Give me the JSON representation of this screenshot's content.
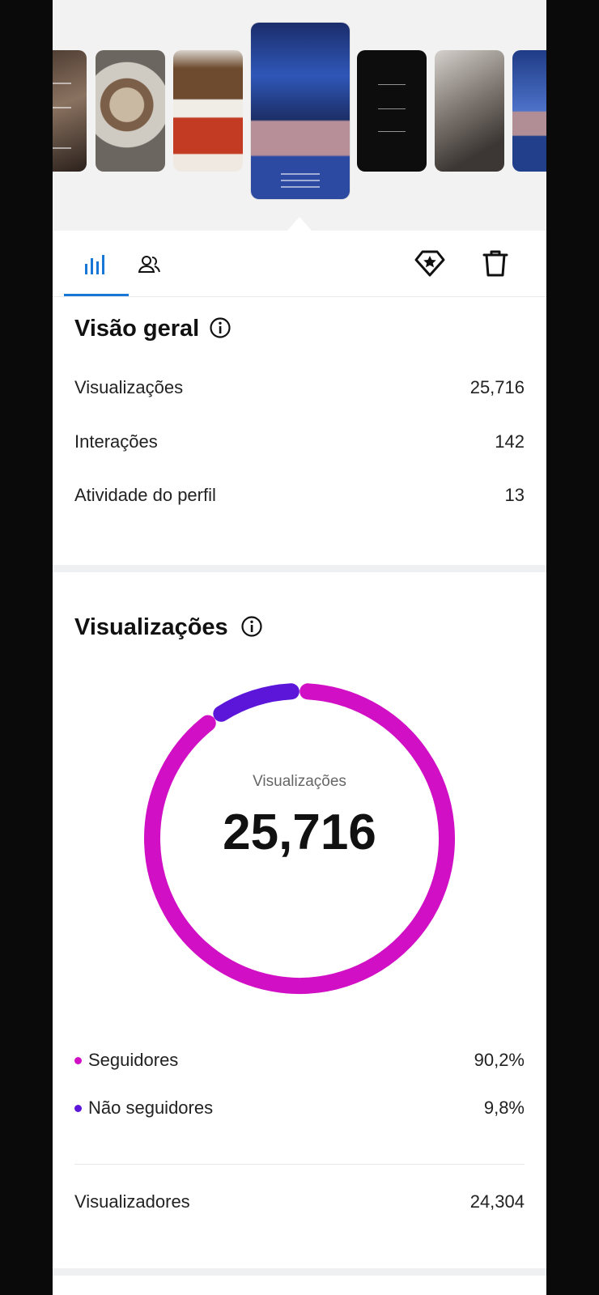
{
  "overview": {
    "title": "Visão geral",
    "rows": [
      {
        "label": "Visualizações",
        "value": "25,716"
      },
      {
        "label": "Interações",
        "value": "142"
      },
      {
        "label": "Atividade do perfil",
        "value": "13"
      }
    ]
  },
  "views": {
    "title": "Visualizações",
    "center_label": "Visualizações",
    "center_value": "25,716",
    "legend": [
      {
        "label": "Seguidores",
        "value": "90,2%",
        "color": "#d10fc4"
      },
      {
        "label": "Não seguidores",
        "value": "9,8%",
        "color": "#5b16d9"
      }
    ],
    "viewers": {
      "label": "Visualizadores",
      "value": "24,304"
    }
  },
  "chart_data": {
    "type": "pie",
    "categories": [
      "Seguidores",
      "Não seguidores"
    ],
    "values": [
      90.2,
      9.8
    ],
    "colors": [
      "#d10fc4",
      "#5b16d9"
    ],
    "title": "",
    "center_label": "Visualizações",
    "center_value": "25,716"
  },
  "colors": {
    "accent_blue": "#1877d6",
    "followers": "#d10fc4",
    "non_followers": "#5b16d9"
  },
  "icons": {
    "tab_insights": "bar-chart-icon",
    "tab_audience": "people-icon",
    "boost": "diamond-star-icon",
    "delete": "trash-icon",
    "info": "info-icon"
  }
}
